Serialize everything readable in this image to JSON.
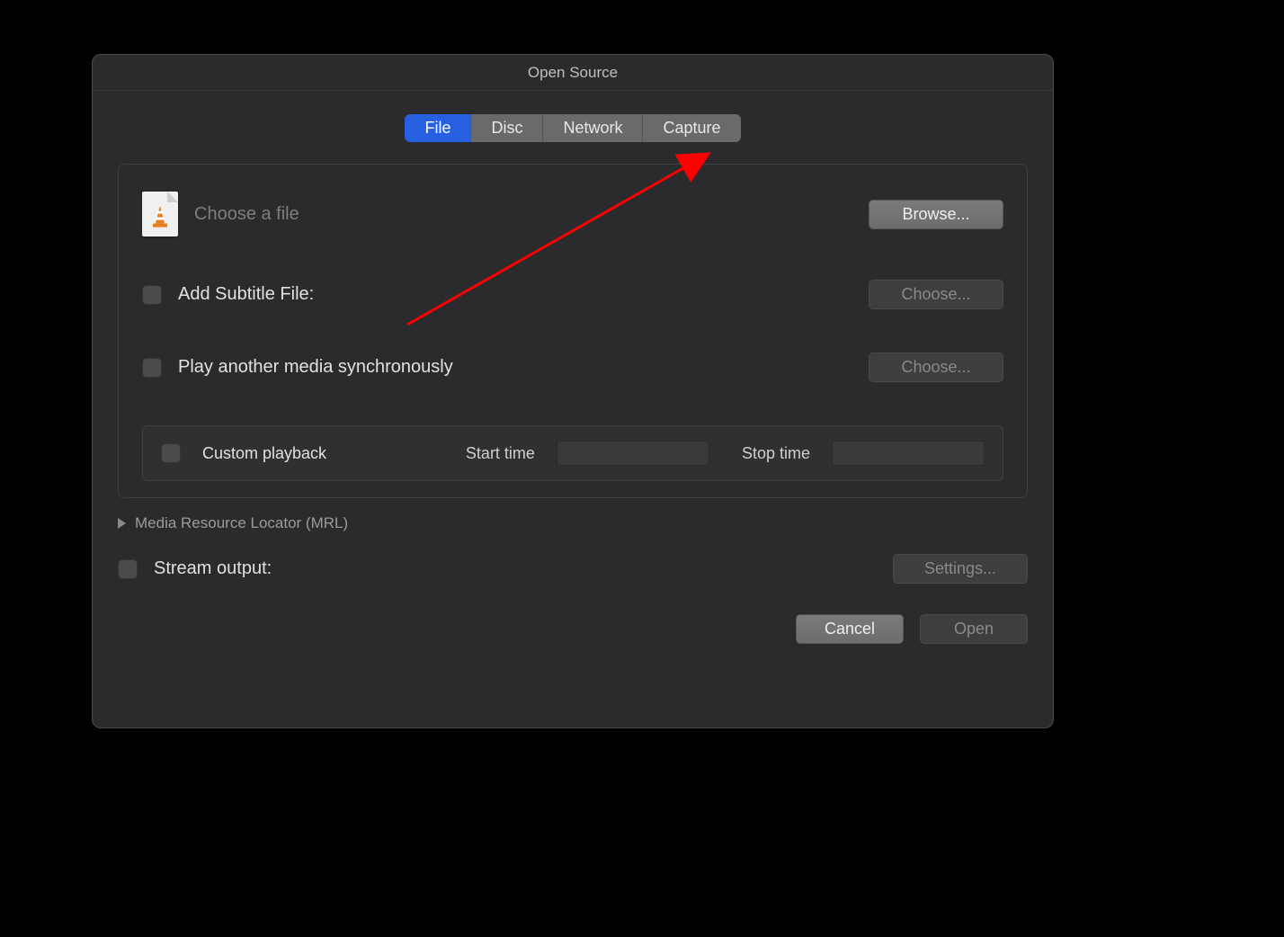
{
  "window": {
    "title": "Open Source"
  },
  "tabs": {
    "file": "File",
    "disc": "Disc",
    "network": "Network",
    "capture": "Capture",
    "active": "file"
  },
  "file_panel": {
    "choose_placeholder": "Choose a file",
    "browse_button": "Browse...",
    "subtitle_label": "Add Subtitle File:",
    "subtitle_choose": "Choose...",
    "sync_label": "Play another media synchronously",
    "sync_choose": "Choose...",
    "custom_playback_label": "Custom playback",
    "start_time_label": "Start time",
    "stop_time_label": "Stop time"
  },
  "mrl": {
    "label": "Media Resource Locator (MRL)"
  },
  "stream": {
    "label": "Stream output:",
    "settings_button": "Settings..."
  },
  "footer": {
    "cancel": "Cancel",
    "open": "Open"
  }
}
